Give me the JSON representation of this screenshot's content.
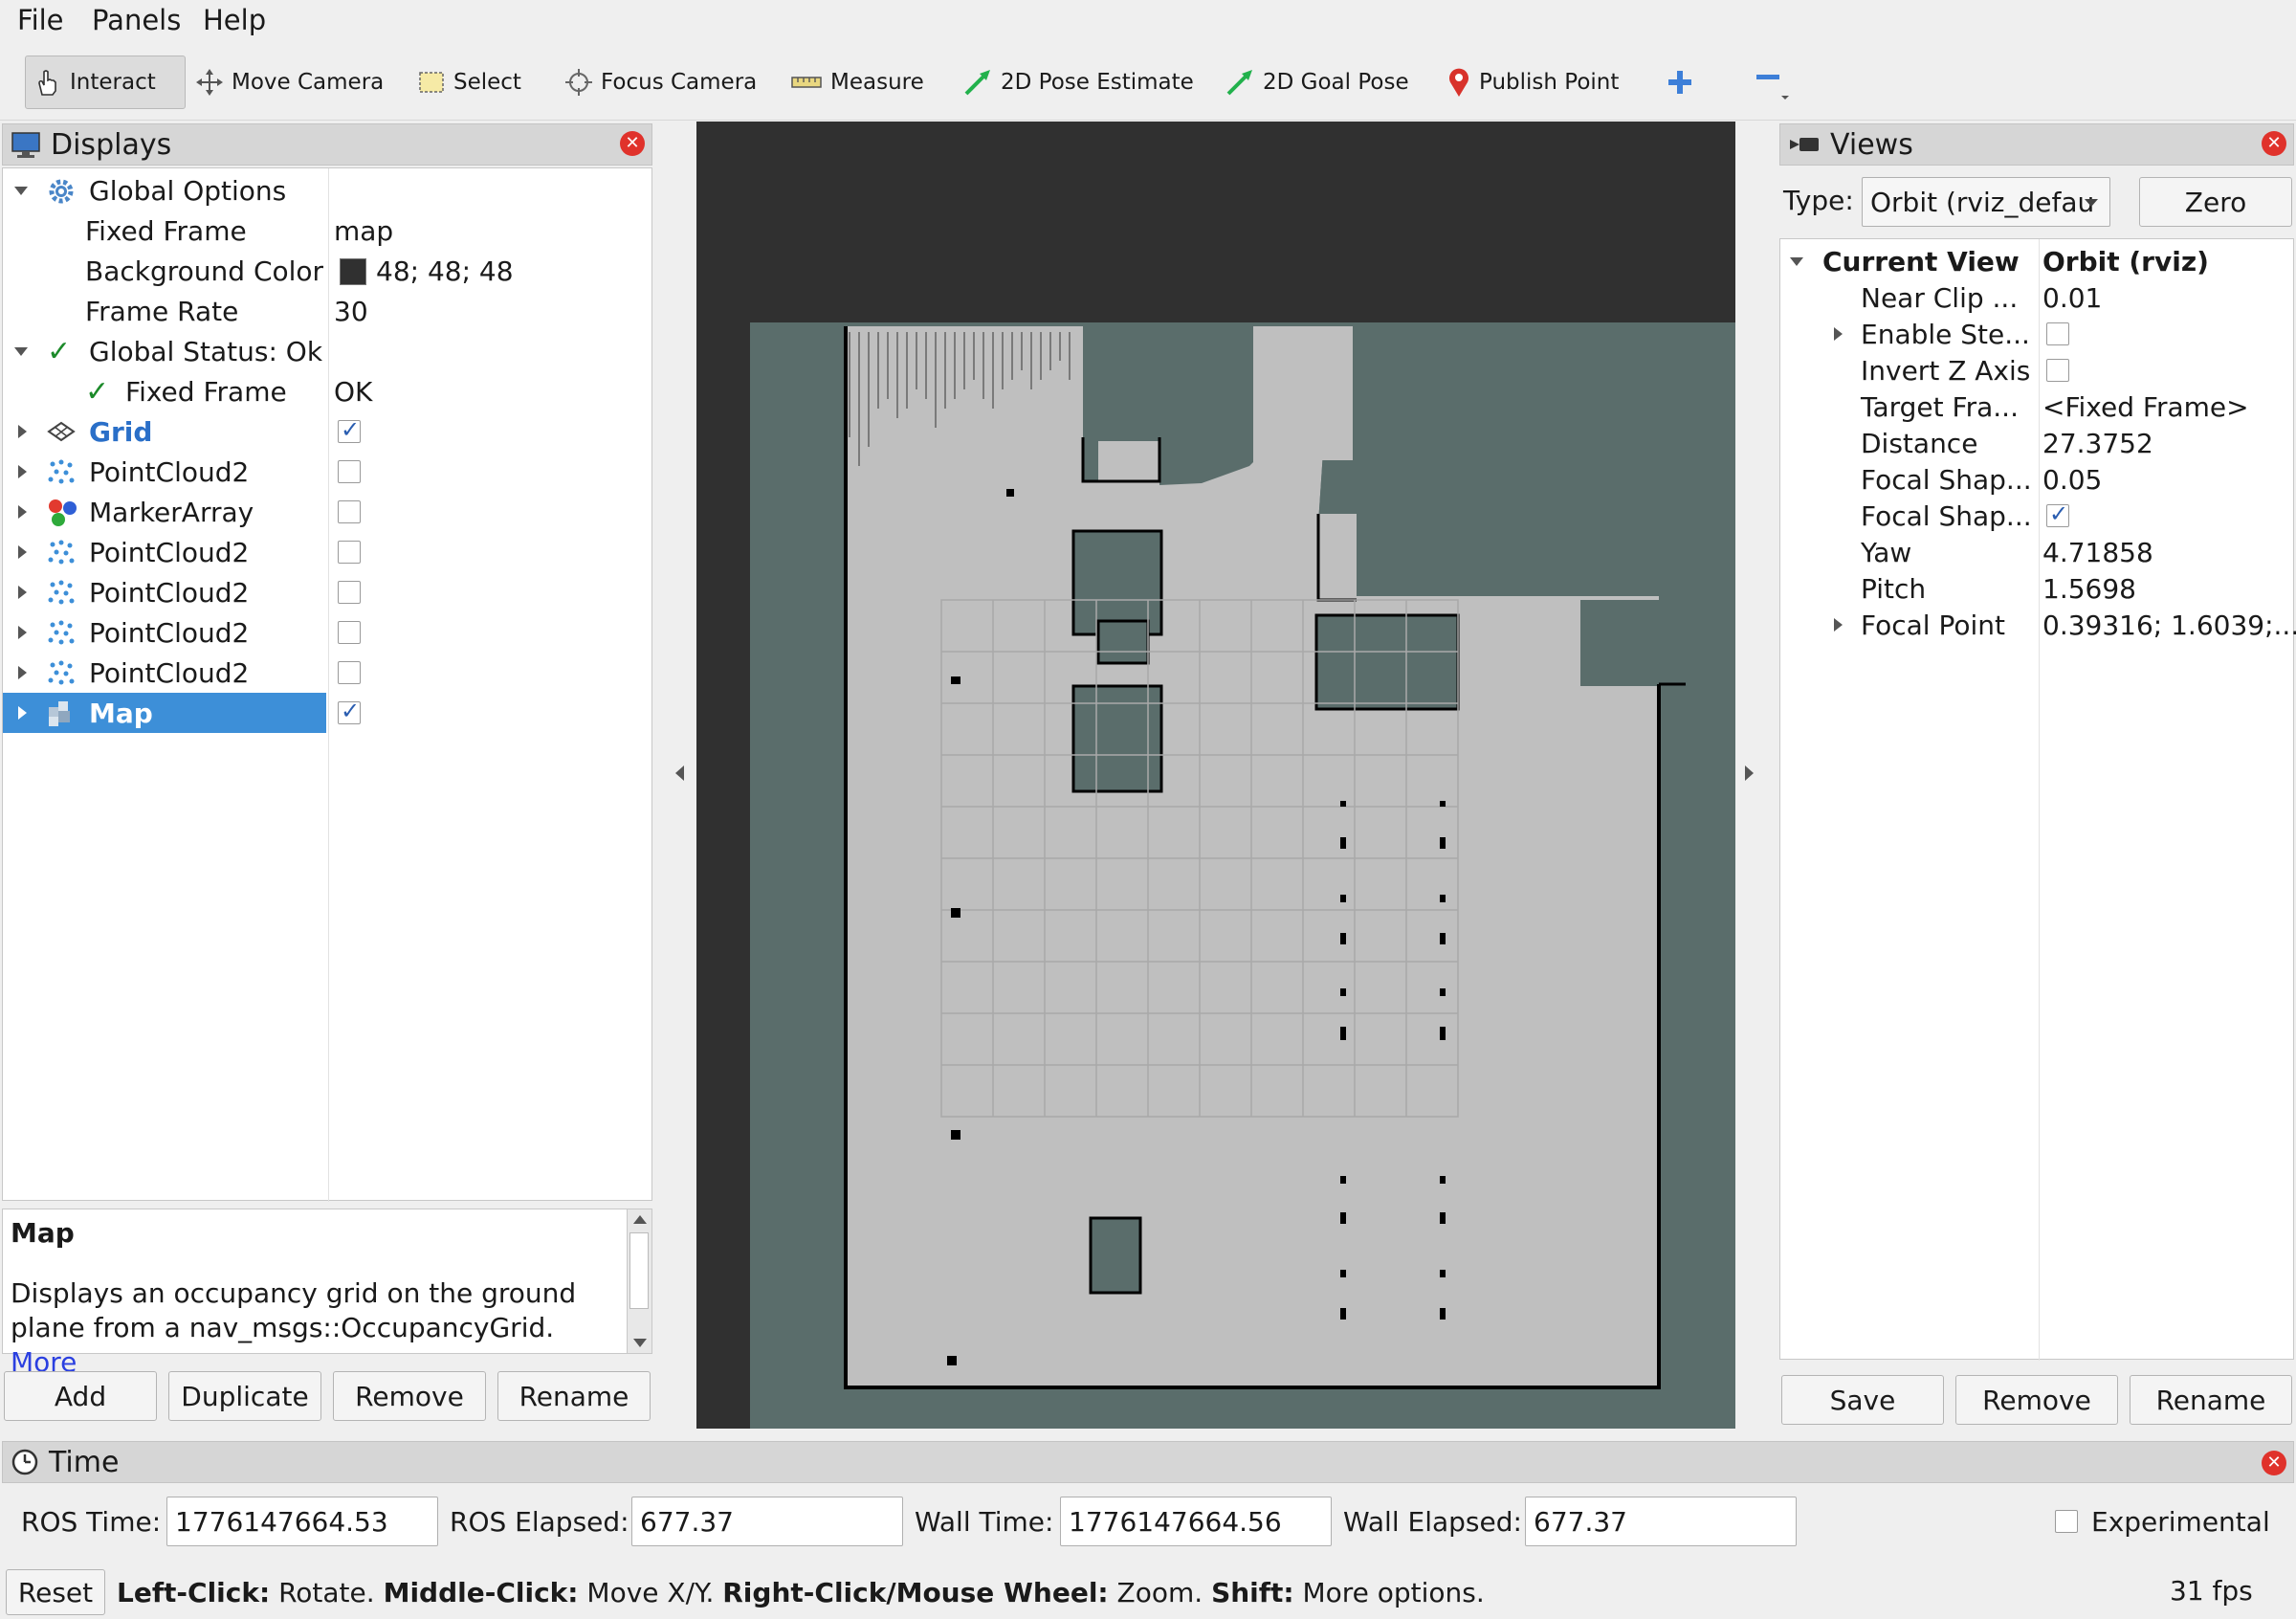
{
  "menu": {
    "file": "File",
    "panels": "Panels",
    "help": "Help"
  },
  "toolbar": {
    "interact": "Interact",
    "move_camera": "Move Camera",
    "select": "Select",
    "focus_camera": "Focus Camera",
    "measure": "Measure",
    "pose_estimate": "2D Pose Estimate",
    "goal_pose": "2D Goal Pose",
    "publish_point": "Publish Point"
  },
  "displays": {
    "title": "Displays",
    "global_options": "Global Options",
    "fixed_frame_label": "Fixed Frame",
    "fixed_frame_value": "map",
    "bg_color_label": "Background Color",
    "bg_color_value": "48; 48; 48",
    "frame_rate_label": "Frame Rate",
    "frame_rate_value": "30",
    "global_status": "Global Status: Ok",
    "status_fixed_frame": "Fixed Frame",
    "status_fixed_frame_value": "OK",
    "items": [
      {
        "label": "Grid",
        "checked": true
      },
      {
        "label": "PointCloud2",
        "checked": false
      },
      {
        "label": "MarkerArray",
        "checked": false
      },
      {
        "label": "PointCloud2",
        "checked": false
      },
      {
        "label": "PointCloud2",
        "checked": false
      },
      {
        "label": "PointCloud2",
        "checked": false
      },
      {
        "label": "PointCloud2",
        "checked": false
      },
      {
        "label": "Map",
        "checked": true
      }
    ],
    "desc_title": "Map",
    "desc_text": "Displays an occupancy grid on the ground plane from a nav_msgs::OccupancyGrid.",
    "desc_more": "More",
    "buttons": {
      "add": "Add",
      "duplicate": "Duplicate",
      "remove": "Remove",
      "rename": "Rename"
    }
  },
  "views": {
    "title": "Views",
    "type_label": "Type:",
    "type_value": "Orbit (rviz_defau",
    "zero": "Zero",
    "current_view": "Current View",
    "current_view_value": "Orbit (rviz)",
    "props": [
      {
        "label": "Near Clip ...",
        "value": "0.01"
      },
      {
        "label": "Enable Ste...",
        "value": ""
      },
      {
        "label": "Invert Z Axis",
        "value": ""
      },
      {
        "label": "Target Fra...",
        "value": "<Fixed Frame>"
      },
      {
        "label": "Distance",
        "value": "27.3752"
      },
      {
        "label": "Focal Shap...",
        "value": "0.05"
      },
      {
        "label": "Focal Shap...",
        "value": ""
      },
      {
        "label": "Yaw",
        "value": "4.71858"
      },
      {
        "label": "Pitch",
        "value": "1.5698"
      },
      {
        "label": "Focal Point",
        "value": "0.39316; 1.6039;..."
      }
    ],
    "buttons": {
      "save": "Save",
      "remove": "Remove",
      "rename": "Rename"
    }
  },
  "time": {
    "title": "Time",
    "ros_time_label": "ROS Time:",
    "ros_time": "1776147664.53",
    "ros_elapsed_label": "ROS Elapsed:",
    "ros_elapsed": "677.37",
    "wall_time_label": "Wall Time:",
    "wall_time": "1776147664.56",
    "wall_elapsed_label": "Wall Elapsed:",
    "wall_elapsed": "677.37",
    "experimental": "Experimental"
  },
  "status": {
    "reset": "Reset",
    "left_click": "Left-Click:",
    "left_click_action": "Rotate.",
    "middle_click": "Middle-Click:",
    "middle_click_action": "Move X/Y.",
    "right_click": "Right-Click/Mouse Wheel:",
    "right_click_action": "Zoom.",
    "shift": "Shift:",
    "shift_action": "More options.",
    "fps": "31 fps"
  },
  "colors": {
    "selection": "#3d8fd8",
    "viewport_bg": "#303030",
    "map_unknown": "#5a6d6b",
    "map_free": "#bfbfbf",
    "map_occupied": "#000000",
    "close_button": "#e0322b"
  }
}
